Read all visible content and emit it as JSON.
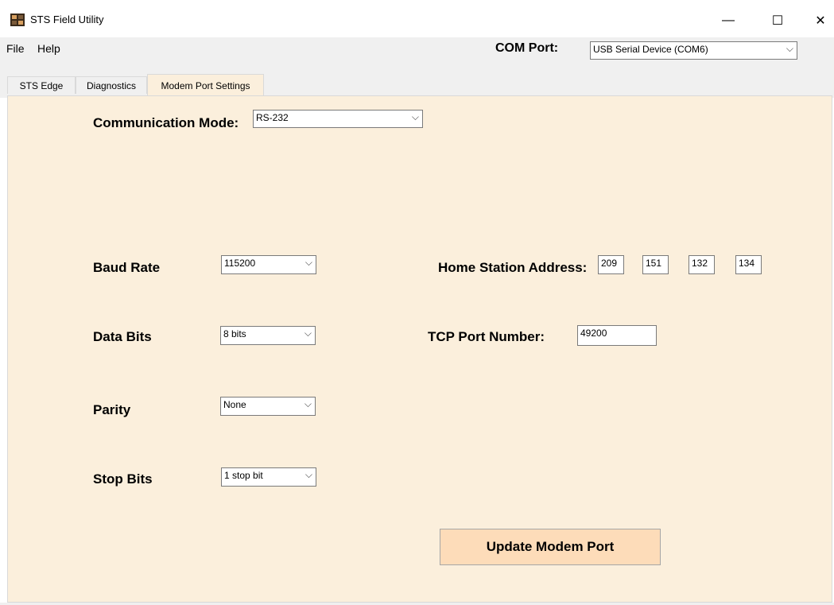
{
  "window": {
    "title": "STS Field Utility",
    "app_icon": "sts-app-icon",
    "controls": {
      "minimize": "—",
      "maximize": "☐",
      "close": "✕"
    }
  },
  "menu": {
    "items": [
      {
        "label": "File"
      },
      {
        "label": "Help"
      }
    ]
  },
  "com_port": {
    "label": "COM Port:",
    "value": "USB Serial Device (COM6)"
  },
  "tabs": [
    {
      "label": "STS Edge",
      "active": false
    },
    {
      "label": "Diagnostics",
      "active": false
    },
    {
      "label": "Modem Port Settings",
      "active": true
    }
  ],
  "communication_mode": {
    "label": "Communication Mode:",
    "value": "RS-232"
  },
  "serial": {
    "baud_rate": {
      "label": "Baud Rate",
      "value": "115200"
    },
    "data_bits": {
      "label": "Data Bits",
      "value": "8 bits"
    },
    "parity": {
      "label": "Parity",
      "value": "None"
    },
    "stop_bits": {
      "label": "Stop Bits",
      "value": "1 stop bit"
    }
  },
  "network": {
    "home_station": {
      "label": "Home Station Address:",
      "octets": [
        "209",
        "151",
        "132",
        "134"
      ]
    },
    "tcp_port": {
      "label": "TCP Port Number:",
      "value": "49200"
    }
  },
  "update_button": {
    "label": "Update Modem Port"
  },
  "colors": {
    "panel_bg": "#fbefdc",
    "button_bg": "#fddcb9",
    "chrome_bg": "#f0f0f0"
  }
}
